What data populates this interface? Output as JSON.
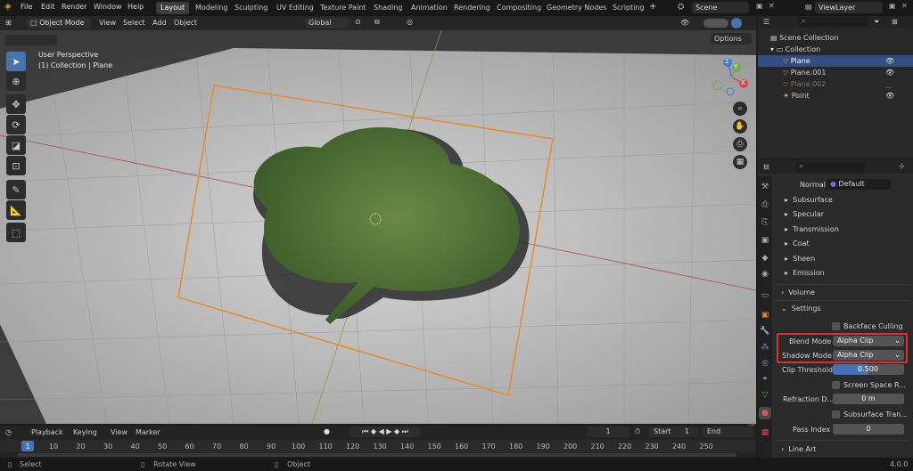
{
  "menu": {
    "file": "File",
    "edit": "Edit",
    "render": "Render",
    "window": "Window",
    "help": "Help"
  },
  "workspaces": [
    "Layout",
    "Modeling",
    "Sculpting",
    "UV Editing",
    "Texture Paint",
    "Shading",
    "Animation",
    "Rendering",
    "Compositing",
    "Geometry Nodes",
    "Scripting"
  ],
  "scene": "Scene",
  "view_layer": "ViewLayer",
  "viewport_header": {
    "mode": "Object Mode",
    "view": "View",
    "select": "Select",
    "add": "Add",
    "object": "Object",
    "orientation": "Global",
    "options": "Options"
  },
  "viewport": {
    "perspective": "User Perspective",
    "collection": "(1) Collection | Plane"
  },
  "gizmo": {
    "x": "X",
    "y": "Y",
    "z": "Z"
  },
  "outliner": {
    "scene_collection": "Scene Collection",
    "collection": "Collection",
    "items": [
      "Plane",
      "Plane.001",
      "Plane.002",
      "Point"
    ]
  },
  "properties": {
    "normal_label": "Normal",
    "normal_value": "Default",
    "panels": [
      "Subsurface",
      "Specular",
      "Transmission",
      "Coat",
      "Sheen",
      "Emission"
    ],
    "volume": "Volume",
    "settings": "Settings",
    "backface_culling": "Backface Culling",
    "blend_mode_label": "Blend Mode",
    "blend_mode_value": "Alpha Clip",
    "shadow_mode_label": "Shadow Mode",
    "shadow_mode_value": "Alpha Clip",
    "clip_threshold_label": "Clip Threshold",
    "clip_threshold_value": "0.500",
    "screen_space": "Screen Space R...",
    "refraction_label": "Refraction D...",
    "refraction_value": "0 m",
    "subsurface_tran": "Subsurface Tran...",
    "pass_index_label": "Pass Index",
    "pass_index_value": "0",
    "line_art": "Line Art"
  },
  "timeline": {
    "playback": "Playback",
    "keying": "Keying",
    "view": "View",
    "marker": "Marker",
    "current_frame": "1",
    "start_label": "Start",
    "start_value": "1",
    "end_label": "End",
    "ticks": [
      "1",
      "10",
      "20",
      "30",
      "40",
      "50",
      "60",
      "70",
      "80",
      "90",
      "100",
      "110",
      "120",
      "130",
      "140",
      "150",
      "160",
      "170",
      "180",
      "190",
      "200",
      "210",
      "220",
      "230",
      "240",
      "250"
    ]
  },
  "status": {
    "select": "Select",
    "rotate": "Rotate View",
    "object": "Object",
    "version": "4.0.0"
  },
  "colors": {
    "accent": "#4772b3",
    "selection": "#e78a2a",
    "highlight_box": "#e0302a",
    "arrow": "#e8322a"
  }
}
